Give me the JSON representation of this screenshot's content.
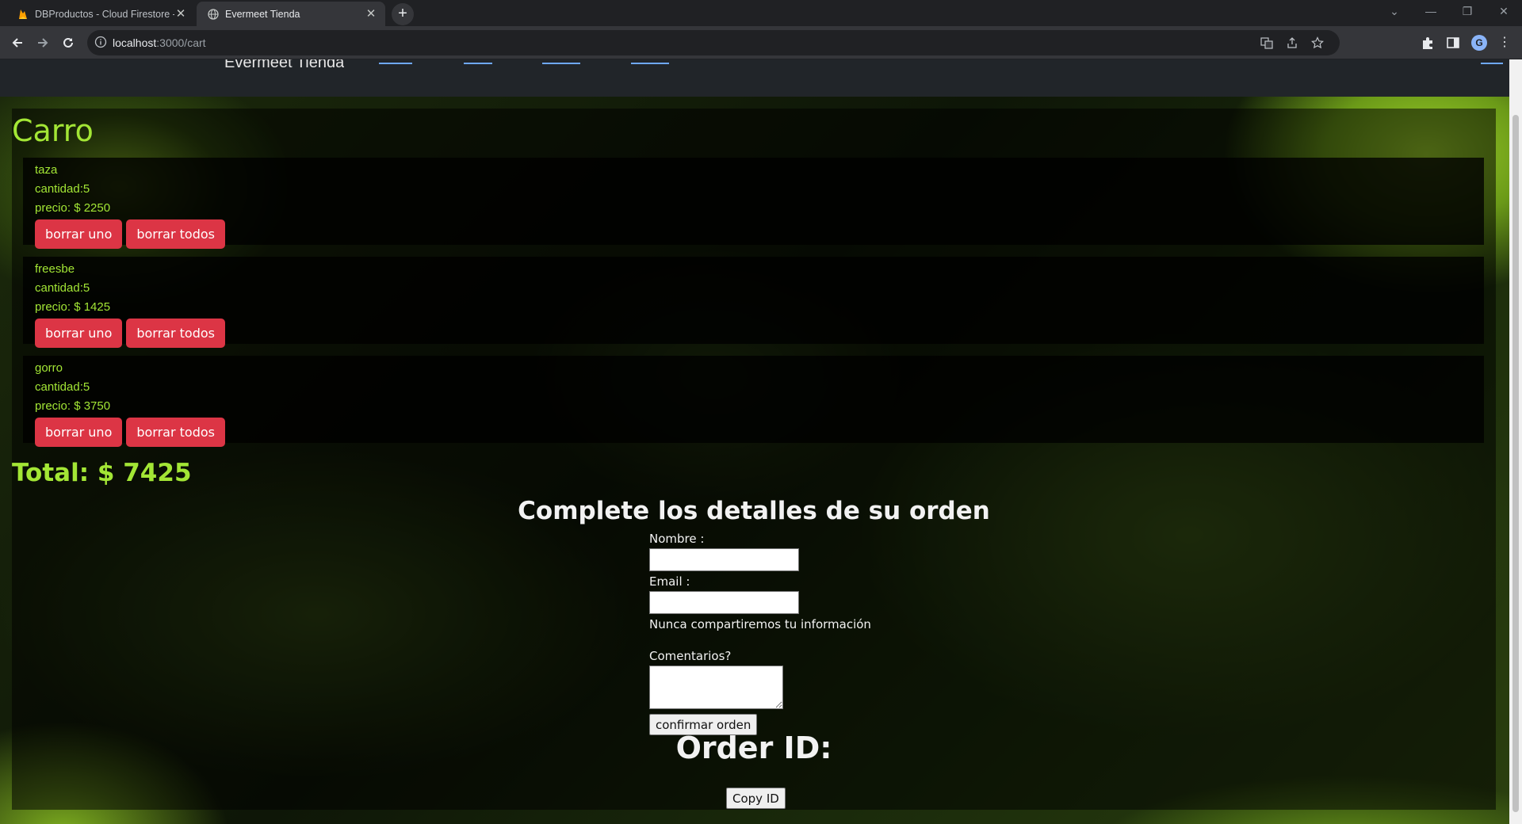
{
  "browser": {
    "tabs": [
      {
        "title": "DBProductos - Cloud Firestore -",
        "active": false
      },
      {
        "title": "Evermeet Tienda",
        "active": true
      }
    ],
    "url_host": "localhost",
    "url_path": ":3000/cart"
  },
  "site": {
    "brand": "Evermeet Tienda"
  },
  "cart": {
    "title": "Carro",
    "items": [
      {
        "name": "taza",
        "qty": "cantidad:5",
        "price": "precio: $ 2250",
        "remove_one": "borrar uno",
        "remove_all": "borrar todos"
      },
      {
        "name": "freesbe",
        "qty": "cantidad:5",
        "price": "precio: $ 1425",
        "remove_one": "borrar uno",
        "remove_all": "borrar todos"
      },
      {
        "name": "gorro",
        "qty": "cantidad:5",
        "price": "precio: $ 3750",
        "remove_one": "borrar uno",
        "remove_all": "borrar todos"
      }
    ],
    "total": "Total: $ 7425"
  },
  "form": {
    "title": "Complete los detalles de su orden",
    "name_label": "Nombre :",
    "name_value": "",
    "email_label": "Email :",
    "email_value": "",
    "email_help": "Nunca compartiremos tu información",
    "comments_label": "Comentarios?",
    "comments_value": "",
    "submit_label": "confirmar orden"
  },
  "order": {
    "title": "Order ID:",
    "copy_label": "Copy ID"
  },
  "colors": {
    "accent": "#a3e635",
    "danger": "#dc3545"
  }
}
